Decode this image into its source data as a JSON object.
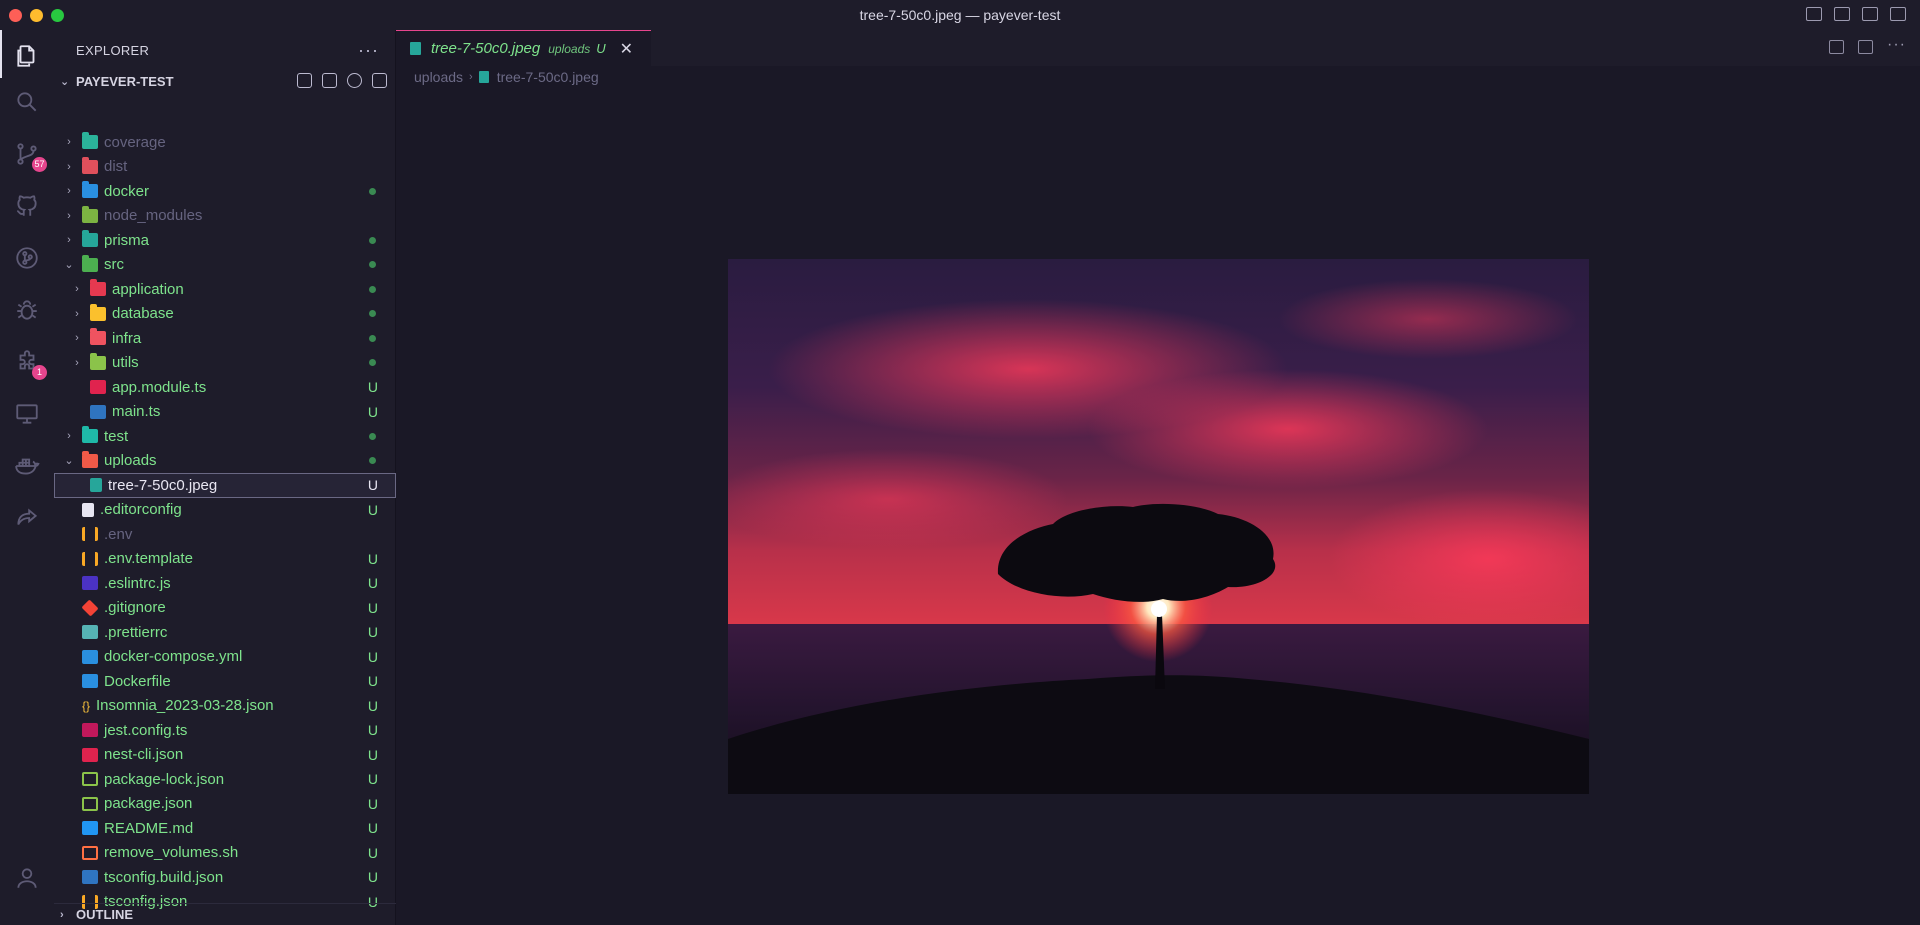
{
  "window": {
    "title": "tree-7-50c0.jpeg — payever-test"
  },
  "activity_bar": {
    "items": [
      {
        "icon": "explorer-icon",
        "active": true
      },
      {
        "icon": "search-icon"
      },
      {
        "icon": "source-control-icon",
        "badge": "57"
      },
      {
        "icon": "github-icon"
      },
      {
        "icon": "git-graph-icon"
      },
      {
        "icon": "debug-icon"
      },
      {
        "icon": "extensions-icon",
        "badge": "1"
      },
      {
        "icon": "remote-explorer-icon"
      },
      {
        "icon": "docker-icon"
      },
      {
        "icon": "live-share-icon"
      },
      {
        "icon": "account-icon"
      }
    ]
  },
  "sidebar": {
    "title": "EXPLORER",
    "project": "PAYEVER-TEST",
    "outline": "OUTLINE",
    "tree": [
      {
        "label": "coverage",
        "type": "folder",
        "depth": 0,
        "icon": "fi-coverage",
        "color": "dim",
        "status": ""
      },
      {
        "label": "dist",
        "type": "folder",
        "depth": 0,
        "icon": "fi-dist",
        "color": "dim",
        "status": ""
      },
      {
        "label": "docker",
        "type": "folder",
        "depth": 0,
        "icon": "fi-docker",
        "color": "green",
        "status": "dot"
      },
      {
        "label": "node_modules",
        "type": "folder",
        "depth": 0,
        "icon": "fi-node",
        "color": "dim",
        "status": ""
      },
      {
        "label": "prisma",
        "type": "folder",
        "depth": 0,
        "icon": "fi-prisma",
        "color": "green",
        "status": "dot"
      },
      {
        "label": "src",
        "type": "folder-open",
        "depth": 0,
        "icon": "fi-src",
        "color": "green",
        "status": "dot"
      },
      {
        "label": "application",
        "type": "folder",
        "depth": 1,
        "icon": "fi-app",
        "color": "green",
        "status": "dot"
      },
      {
        "label": "database",
        "type": "folder",
        "depth": 1,
        "icon": "fi-db",
        "color": "green",
        "status": "dot"
      },
      {
        "label": "infra",
        "type": "folder",
        "depth": 1,
        "icon": "fi-infra",
        "color": "green",
        "status": "dot"
      },
      {
        "label": "utils",
        "type": "folder",
        "depth": 1,
        "icon": "fi-utils",
        "color": "green",
        "status": "dot"
      },
      {
        "label": "app.module.ts",
        "type": "file",
        "depth": 1,
        "icon": "fi-nest",
        "color": "green",
        "status": "U"
      },
      {
        "label": "main.ts",
        "type": "file",
        "depth": 1,
        "icon": "fi-ts",
        "color": "green",
        "status": "U"
      },
      {
        "label": "test",
        "type": "folder",
        "depth": 0,
        "icon": "fi-test",
        "color": "green",
        "status": "dot"
      },
      {
        "label": "uploads",
        "type": "folder-open",
        "depth": 0,
        "icon": "fi-uploads",
        "color": "green",
        "status": "dot"
      },
      {
        "label": "tree-7-50c0.jpeg",
        "type": "file",
        "depth": 1,
        "icon": "fi-img",
        "color": "white",
        "status": "U",
        "selected": true
      },
      {
        "label": ".editorconfig",
        "type": "file",
        "depth": 0,
        "icon": "fi-ec",
        "color": "green",
        "status": "U"
      },
      {
        "label": ".env",
        "type": "file",
        "depth": 0,
        "icon": "fi-tune",
        "color": "dim",
        "status": ""
      },
      {
        "label": ".env.template",
        "type": "file",
        "depth": 0,
        "icon": "fi-tune",
        "color": "green",
        "status": "U"
      },
      {
        "label": ".eslintrc.js",
        "type": "file",
        "depth": 0,
        "icon": "fi-eslint",
        "color": "green",
        "status": "U"
      },
      {
        "label": ".gitignore",
        "type": "file",
        "depth": 0,
        "icon": "fi-git",
        "color": "green",
        "status": "U"
      },
      {
        "label": ".prettierrc",
        "type": "file",
        "depth": 0,
        "icon": "fi-prettier",
        "color": "green",
        "status": "U"
      },
      {
        "label": "docker-compose.yml",
        "type": "file",
        "depth": 0,
        "icon": "fi-docker",
        "color": "green",
        "status": "U"
      },
      {
        "label": "Dockerfile",
        "type": "file",
        "depth": 0,
        "icon": "fi-dockerfile",
        "color": "green",
        "status": "U"
      },
      {
        "label": "Insomnia_2023-03-28.json",
        "type": "file",
        "depth": 0,
        "icon": "fi-json",
        "color": "green",
        "status": "U"
      },
      {
        "label": "jest.config.ts",
        "type": "file",
        "depth": 0,
        "icon": "fi-jest",
        "color": "green",
        "status": "U"
      },
      {
        "label": "nest-cli.json",
        "type": "file",
        "depth": 0,
        "icon": "fi-nest",
        "color": "green",
        "status": "U"
      },
      {
        "label": "package-lock.json",
        "type": "file",
        "depth": 0,
        "icon": "fi-npm",
        "color": "green",
        "status": "U"
      },
      {
        "label": "package.json",
        "type": "file",
        "depth": 0,
        "icon": "fi-npm",
        "color": "green",
        "status": "U"
      },
      {
        "label": "README.md",
        "type": "file",
        "depth": 0,
        "icon": "fi-info",
        "color": "green",
        "status": "U"
      },
      {
        "label": "remove_volumes.sh",
        "type": "file",
        "depth": 0,
        "icon": "fi-sh",
        "color": "green",
        "status": "U"
      },
      {
        "label": "tsconfig.build.json",
        "type": "file",
        "depth": 0,
        "icon": "fi-tsconf",
        "color": "green",
        "status": "U"
      },
      {
        "label": "tsconfig.json",
        "type": "file",
        "depth": 0,
        "icon": "fi-tune",
        "color": "green",
        "status": "U"
      }
    ]
  },
  "editor": {
    "tab": {
      "name": "tree-7-50c0.jpeg",
      "description": "uploads",
      "status": "U"
    },
    "breadcrumb": {
      "folder": "uploads",
      "file": "tree-7-50c0.jpeg"
    }
  },
  "colors": {
    "accent": "#e6458d",
    "untracked": "#7ee38c",
    "background": "#1a1826"
  }
}
